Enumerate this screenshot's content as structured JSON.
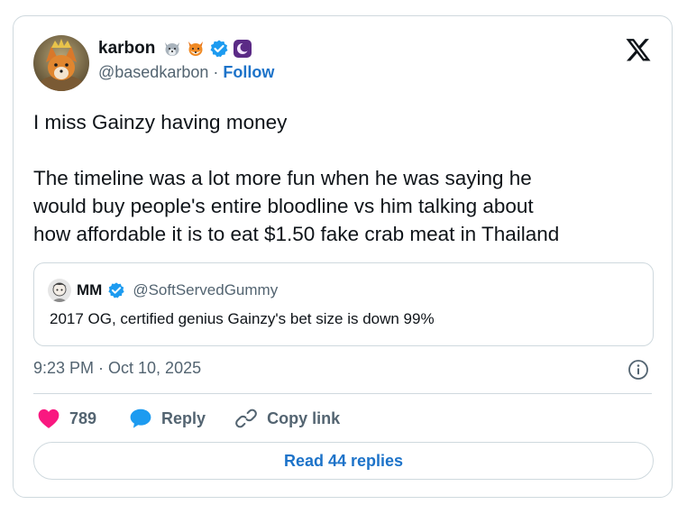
{
  "author": {
    "display_name": "karbon",
    "handle": "@basedkarbon",
    "separator": "·",
    "follow_label": "Follow",
    "badges": [
      "wolf-emoji",
      "fox-emoji",
      "verified-badge",
      "moon-emoji"
    ]
  },
  "tweet": {
    "line1": "I miss Gainzy having money",
    "line2": "The timeline was a lot more fun when he was saying he",
    "line3": "would buy people's entire bloodline vs him talking about",
    "line4": "how affordable it is to eat $1.50 fake crab meat in Thailand"
  },
  "quote": {
    "display_name": "MM",
    "handle": "@SoftServedGummy",
    "text": "2017 OG, certified genius Gainzy's bet size is down 99%"
  },
  "meta": {
    "timestamp": "9:23 PM · Oct 10, 2025"
  },
  "actions": {
    "like_count": "789",
    "reply_label": "Reply",
    "copy_link_label": "Copy link"
  },
  "footer": {
    "read_replies_label": "Read 44 replies"
  },
  "colors": {
    "like": "#f91880",
    "reply": "#1d9bf0",
    "link_blue": "#1d73c9",
    "muted": "#536471",
    "border": "#cfd9de"
  }
}
